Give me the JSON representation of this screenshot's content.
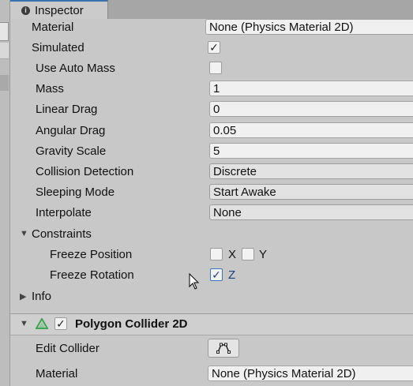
{
  "window": {
    "tab_title": "Inspector"
  },
  "rigidbody": {
    "material_label": "Material",
    "material_value": "None (Physics Material 2D)",
    "simulated_label": "Simulated",
    "simulated_checked": true,
    "use_auto_mass_label": "Use Auto Mass",
    "use_auto_mass_checked": false,
    "mass_label": "Mass",
    "mass_value": "1",
    "linear_drag_label": "Linear Drag",
    "linear_drag_value": "0",
    "angular_drag_label": "Angular Drag",
    "angular_drag_value": "0.05",
    "gravity_scale_label": "Gravity Scale",
    "gravity_scale_value": "5",
    "collision_detection_label": "Collision Detection",
    "collision_detection_value": "Discrete",
    "sleeping_mode_label": "Sleeping Mode",
    "sleeping_mode_value": "Start Awake",
    "interpolate_label": "Interpolate",
    "interpolate_value": "None",
    "constraints_label": "Constraints",
    "freeze_position_label": "Freeze Position",
    "freeze_position_x_label": "X",
    "freeze_position_x_checked": false,
    "freeze_position_y_label": "Y",
    "freeze_position_y_checked": false,
    "freeze_rotation_label": "Freeze Rotation",
    "freeze_rotation_z_label": "Z",
    "freeze_rotation_z_checked": true,
    "info_label": "Info"
  },
  "polygon_collider": {
    "title": "Polygon Collider 2D",
    "enabled": true,
    "edit_collider_label": "Edit Collider",
    "material_label": "Material",
    "material_value": "None (Physics Material 2D)"
  },
  "icons": {
    "info": "info-icon",
    "checkmark": "✓",
    "expand_open": "▼",
    "expand_closed": "▶"
  },
  "colors": {
    "accent_blue": "#3a72b0",
    "collider_green": "#3aa552"
  }
}
